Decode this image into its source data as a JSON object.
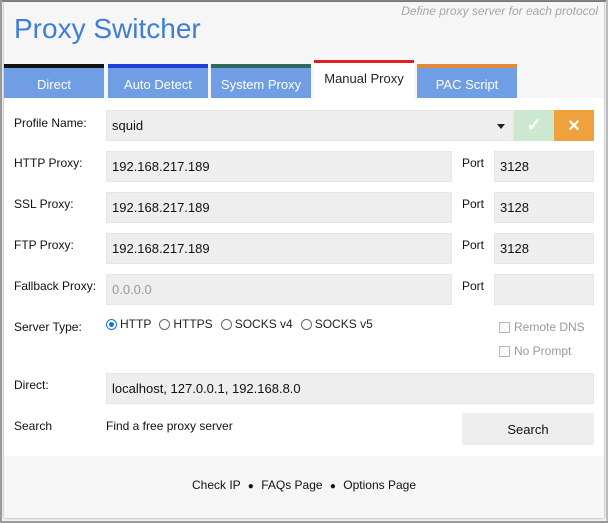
{
  "header": {
    "title": "Proxy Switcher",
    "subtitle": "Define proxy server for each protocol"
  },
  "tabs": [
    {
      "label": "Direct",
      "color": "#111111",
      "active": false
    },
    {
      "label": "Auto Detect",
      "color": "#1f3fd6",
      "active": false
    },
    {
      "label": "System Proxy",
      "color": "#2e6b5c",
      "active": false
    },
    {
      "label": "Manual Proxy",
      "color": "#e02020",
      "active": true
    },
    {
      "label": "PAC Script",
      "color": "#e08a3c",
      "active": false
    }
  ],
  "form": {
    "profile_label": "Profile Name:",
    "profile_value": "squid",
    "http_label": "HTTP Proxy:",
    "http_value": "192.168.217.189",
    "ssl_label": "SSL Proxy:",
    "ssl_value": "192.168.217.189",
    "ftp_label": "FTP Proxy:",
    "ftp_value": "192.168.217.189",
    "fallback_label": "Fallback Proxy:",
    "fallback_placeholder": "0.0.0.0",
    "port_label": "Port",
    "http_port": "3128",
    "ssl_port": "3128",
    "ftp_port": "3128",
    "fallback_port": "",
    "server_type_label": "Server Type:",
    "server_types": [
      {
        "label": "HTTP",
        "checked": true
      },
      {
        "label": "HTTPS",
        "checked": false
      },
      {
        "label": "SOCKS v4",
        "checked": false
      },
      {
        "label": "SOCKS v5",
        "checked": false
      }
    ],
    "remote_dns_label": "Remote DNS",
    "no_prompt_label": "No Prompt",
    "direct_label": "Direct:",
    "direct_value": "localhost, 127.0.0.1, 192.168.8.0",
    "search_label": "Search",
    "search_text": "Find a free proxy server",
    "search_button": "Search"
  },
  "footer": {
    "links": [
      "Check IP",
      "FAQs Page",
      "Options Page"
    ],
    "separator": "●"
  },
  "colors": {
    "accent": "#3d7fd6",
    "tab_bg": "#6f9ee5",
    "ok_btn": "#cde8d0",
    "cancel_btn": "#f0a03c"
  }
}
